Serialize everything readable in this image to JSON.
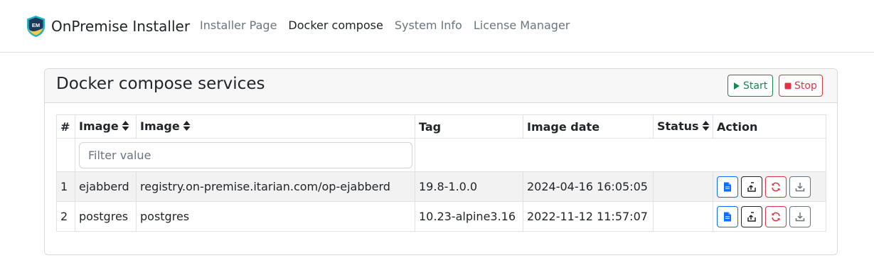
{
  "app": {
    "brand_name": "OnPremise Installer",
    "logo_text": "EM",
    "nav": [
      {
        "label": "Installer Page",
        "active": false
      },
      {
        "label": "Docker compose",
        "active": true
      },
      {
        "label": "System Info",
        "active": false
      },
      {
        "label": "License Manager",
        "active": false
      }
    ]
  },
  "card": {
    "title": "Docker compose services",
    "start_label": "Start",
    "stop_label": "Stop"
  },
  "table": {
    "columns": [
      "#",
      "Image",
      "Image",
      "Tag",
      "Image date",
      "Status",
      "Action"
    ],
    "sortable_columns": [
      "Image",
      "Image",
      "Status"
    ],
    "filter_placeholder": "Filter value",
    "rows": [
      {
        "num": "1",
        "service": "ejabberd",
        "image": "registry.on-premise.itarian.com/op-ejabberd",
        "tag": "19.8-1.0.0",
        "date": "2024-04-16 16:05:05",
        "status": ""
      },
      {
        "num": "2",
        "service": "postgres",
        "image": "postgres",
        "tag": "10.23-alpine3.16",
        "date": "2022-11-12 11:57:07",
        "status": ""
      }
    ],
    "row_actions": [
      "document-icon",
      "upload-icon",
      "restart-icon",
      "download-icon"
    ]
  },
  "colors": {
    "primary": "#0d6efd",
    "success": "#198754",
    "danger": "#dc3545",
    "secondary": "#6c757d",
    "logo_dark": "#1b3a5c",
    "logo_teal": "#22b5c7"
  }
}
